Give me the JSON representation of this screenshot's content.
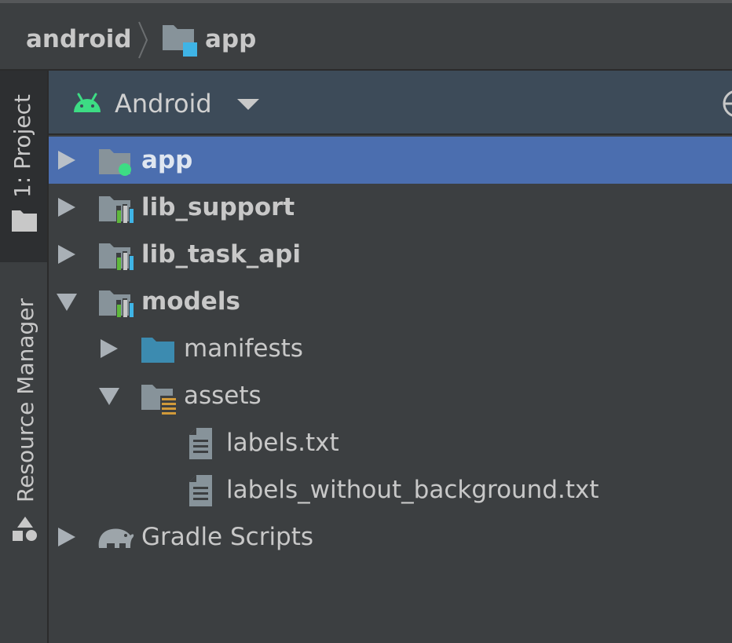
{
  "breadcrumb": {
    "root": "android",
    "current": "app"
  },
  "tool_window_strip": {
    "project_label": "1: Project",
    "resource_manager_label": "Resource Manager"
  },
  "project_panel": {
    "view_mode": "Android"
  },
  "tree": {
    "items": [
      {
        "label": "app",
        "icon": "app-module-icon",
        "expanded": false,
        "selected": true
      },
      {
        "label": "lib_support",
        "icon": "library-module-icon",
        "expanded": false
      },
      {
        "label": "lib_task_api",
        "icon": "library-module-icon",
        "expanded": false
      },
      {
        "label": "models",
        "icon": "library-module-icon",
        "expanded": true
      },
      {
        "label": "manifests",
        "icon": "folder-icon",
        "expanded": false
      },
      {
        "label": "assets",
        "icon": "assets-folder-icon",
        "expanded": true
      },
      {
        "label": "labels.txt",
        "icon": "text-file-icon"
      },
      {
        "label": "labels_without_background.txt",
        "icon": "text-file-icon"
      },
      {
        "label": "Gradle Scripts",
        "icon": "gradle-elephant-icon",
        "expanded": false
      }
    ]
  },
  "colors": {
    "background": "#3c3f41",
    "header": "#3d4b59",
    "selection": "#4b6eaf",
    "text": "#c8c8c8",
    "android_green": "#3ddc84",
    "module_blue": "#3fb4e6",
    "module_green": "#5fb83c",
    "folder_gray": "#87939a",
    "manifest_folder": "#3c8bb0",
    "assets_orange": "#d19a3a"
  }
}
